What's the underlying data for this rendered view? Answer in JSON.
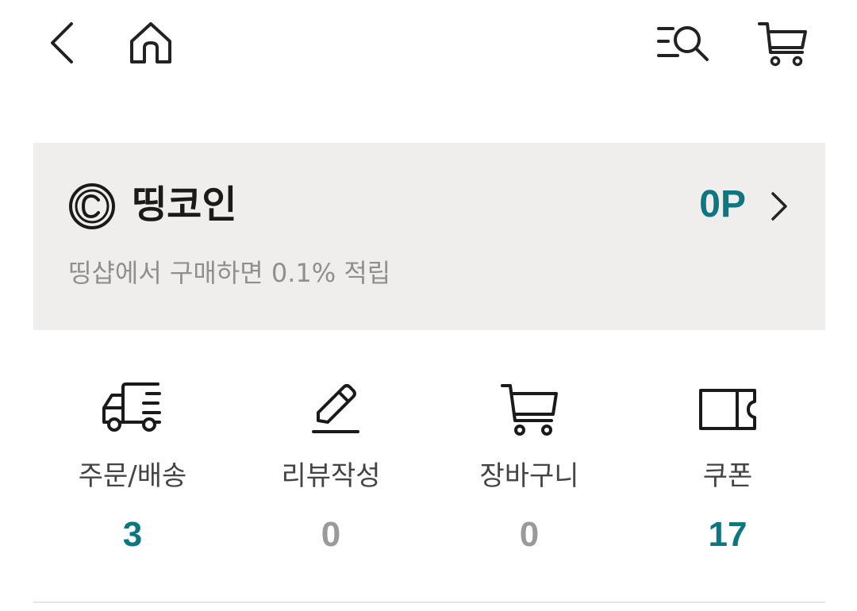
{
  "header": {
    "back_icon": "back-arrow-icon",
    "home_icon": "home-icon",
    "search_icon": "search-menu-icon",
    "cart_icon": "cart-icon"
  },
  "coin": {
    "title": "띵코인",
    "amount": "0P",
    "description": "띵샵에서 구매하면 0.1% 적립",
    "icon": "copyright-coin-icon",
    "accent_color": "#0d7680"
  },
  "quick_menu": [
    {
      "label": "주문/배송",
      "count": "3",
      "icon": "delivery-truck-icon"
    },
    {
      "label": "리뷰작성",
      "count": "0",
      "icon": "pencil-icon"
    },
    {
      "label": "장바구니",
      "count": "0",
      "icon": "cart-icon"
    },
    {
      "label": "쿠폰",
      "count": "17",
      "icon": "coupon-icon"
    }
  ]
}
